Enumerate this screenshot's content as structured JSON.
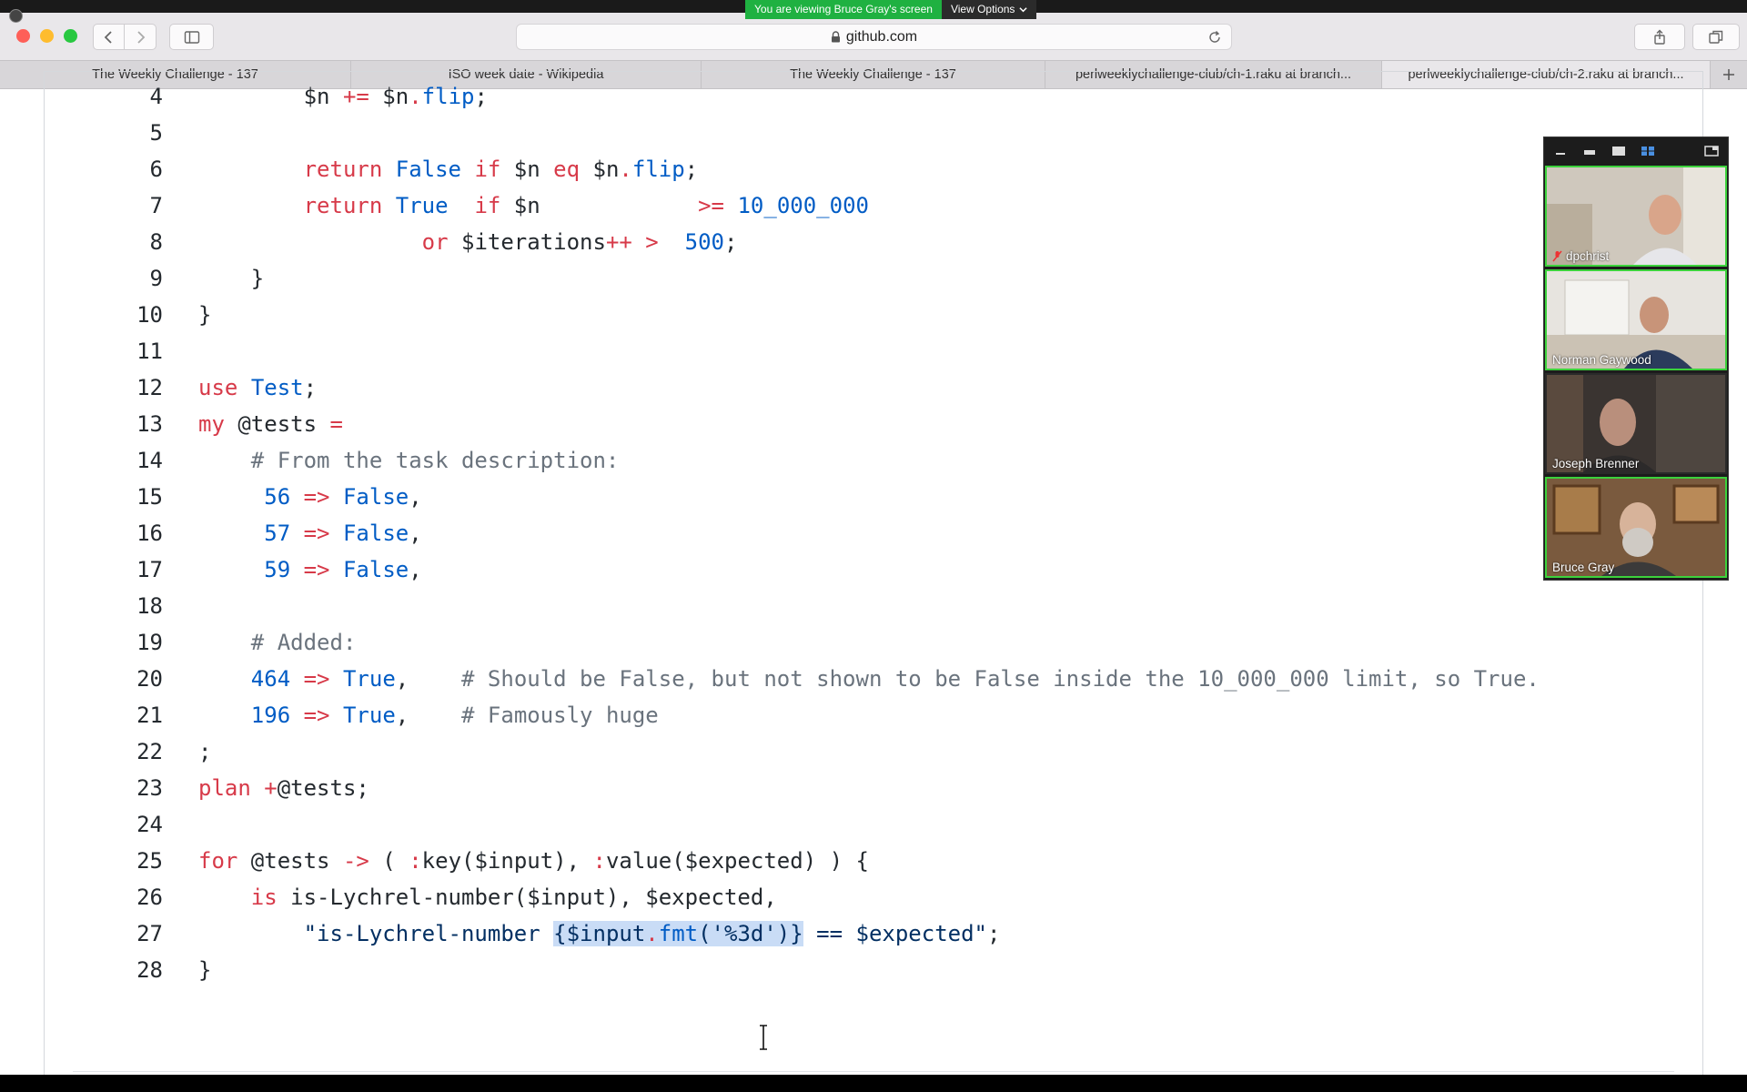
{
  "share_banner": {
    "viewing_text": "You are viewing Bruce Gray's screen",
    "view_options_label": "View Options"
  },
  "toolbar": {
    "url": "github.com",
    "icons": [
      "back-icon",
      "forward-icon",
      "sidebar-icon",
      "lock-icon",
      "reload-icon",
      "share-icon",
      "tabs-overview-icon"
    ]
  },
  "tabs": [
    {
      "label": "The Weekly Challenge - 137",
      "active": false
    },
    {
      "label": "ISO week date - Wikipedia",
      "active": false
    },
    {
      "label": "The Weekly Challenge - 137",
      "active": false
    },
    {
      "label": "perlweeklychallenge-club/ch-1.raku at branch...",
      "active": false
    },
    {
      "label": "perlweeklychallenge-club/ch-2.raku at branch...",
      "active": true
    }
  ],
  "code": {
    "lines": [
      {
        "n": "4",
        "segs": [
          [
            "",
            "        $n "
          ],
          [
            "kw",
            "+="
          ],
          [
            "",
            " $n"
          ],
          [
            "kw",
            "."
          ],
          [
            "fn",
            "flip"
          ],
          [
            "",
            ";"
          ]
        ]
      },
      {
        "n": "5",
        "segs": []
      },
      {
        "n": "6",
        "segs": [
          [
            "",
            "        "
          ],
          [
            "kw",
            "return"
          ],
          [
            "",
            " "
          ],
          [
            "fn",
            "False"
          ],
          [
            "",
            " "
          ],
          [
            "kw",
            "if"
          ],
          [
            "",
            " $n "
          ],
          [
            "kw",
            "eq"
          ],
          [
            "",
            " $n"
          ],
          [
            "kw",
            "."
          ],
          [
            "fn",
            "flip"
          ],
          [
            "",
            ";"
          ]
        ]
      },
      {
        "n": "7",
        "segs": [
          [
            "",
            "        "
          ],
          [
            "kw",
            "return"
          ],
          [
            "",
            " "
          ],
          [
            "fn",
            "True"
          ],
          [
            "",
            "  "
          ],
          [
            "kw",
            "if"
          ],
          [
            "",
            " $n            "
          ],
          [
            "kw",
            ">="
          ],
          [
            "",
            " "
          ],
          [
            "num",
            "10_000_000"
          ]
        ]
      },
      {
        "n": "8",
        "segs": [
          [
            "",
            "                 "
          ],
          [
            "kw",
            "or"
          ],
          [
            "",
            " $iterations"
          ],
          [
            "kw",
            "++"
          ],
          [
            "",
            " "
          ],
          [
            "kw",
            ">"
          ],
          [
            "",
            "  "
          ],
          [
            "num",
            "500"
          ],
          [
            "",
            ";"
          ]
        ]
      },
      {
        "n": "9",
        "segs": [
          [
            "",
            "    }"
          ]
        ]
      },
      {
        "n": "10",
        "segs": [
          [
            "",
            "}"
          ]
        ]
      },
      {
        "n": "11",
        "segs": []
      },
      {
        "n": "12",
        "segs": [
          [
            "kw",
            "use"
          ],
          [
            "",
            " "
          ],
          [
            "fn",
            "Test"
          ],
          [
            "",
            ";"
          ]
        ]
      },
      {
        "n": "13",
        "segs": [
          [
            "kw",
            "my"
          ],
          [
            "",
            " @tests "
          ],
          [
            "kw",
            "="
          ]
        ]
      },
      {
        "n": "14",
        "segs": [
          [
            "",
            "    "
          ],
          [
            "cm",
            "# From the task description:"
          ]
        ]
      },
      {
        "n": "15",
        "segs": [
          [
            "",
            "     "
          ],
          [
            "num",
            "56"
          ],
          [
            "",
            " "
          ],
          [
            "kw",
            "=>"
          ],
          [
            "",
            " "
          ],
          [
            "fn",
            "False"
          ],
          [
            "",
            ","
          ]
        ]
      },
      {
        "n": "16",
        "segs": [
          [
            "",
            "     "
          ],
          [
            "num",
            "57"
          ],
          [
            "",
            " "
          ],
          [
            "kw",
            "=>"
          ],
          [
            "",
            " "
          ],
          [
            "fn",
            "False"
          ],
          [
            "",
            ","
          ]
        ]
      },
      {
        "n": "17",
        "segs": [
          [
            "",
            "     "
          ],
          [
            "num",
            "59"
          ],
          [
            "",
            " "
          ],
          [
            "kw",
            "=>"
          ],
          [
            "",
            " "
          ],
          [
            "fn",
            "False"
          ],
          [
            "",
            ","
          ]
        ]
      },
      {
        "n": "18",
        "segs": []
      },
      {
        "n": "19",
        "segs": [
          [
            "",
            "    "
          ],
          [
            "cm",
            "# Added:"
          ]
        ]
      },
      {
        "n": "20",
        "segs": [
          [
            "",
            "    "
          ],
          [
            "num",
            "464"
          ],
          [
            "",
            " "
          ],
          [
            "kw",
            "=>"
          ],
          [
            "",
            " "
          ],
          [
            "fn",
            "True"
          ],
          [
            "",
            ",    "
          ],
          [
            "cm",
            "# Should be False, but not shown to be False inside the 10_000_000 limit, so True."
          ]
        ]
      },
      {
        "n": "21",
        "segs": [
          [
            "",
            "    "
          ],
          [
            "num",
            "196"
          ],
          [
            "",
            " "
          ],
          [
            "kw",
            "=>"
          ],
          [
            "",
            " "
          ],
          [
            "fn",
            "True"
          ],
          [
            "",
            ",    "
          ],
          [
            "cm",
            "# Famously huge"
          ]
        ]
      },
      {
        "n": "22",
        "segs": [
          [
            "",
            ";"
          ]
        ]
      },
      {
        "n": "23",
        "segs": [
          [
            "kw",
            "plan"
          ],
          [
            "",
            " "
          ],
          [
            "kw",
            "+"
          ],
          [
            "",
            "@tests;"
          ]
        ]
      },
      {
        "n": "24",
        "segs": []
      },
      {
        "n": "25",
        "segs": [
          [
            "kw",
            "for"
          ],
          [
            "",
            " @tests "
          ],
          [
            "kw",
            "->"
          ],
          [
            "",
            " ( "
          ],
          [
            "kw",
            ":"
          ],
          [
            "",
            "key($input), "
          ],
          [
            "kw",
            ":"
          ],
          [
            "",
            "value($expected) ) {"
          ]
        ]
      },
      {
        "n": "26",
        "segs": [
          [
            "",
            "    "
          ],
          [
            "kw",
            "is"
          ],
          [
            "",
            " is-Lychrel-number($input), $expected,"
          ]
        ]
      },
      {
        "n": "27",
        "segs": [
          [
            "",
            "        "
          ],
          [
            "str",
            "\"is-Lychrel-number "
          ],
          [
            "hl",
            "{$input"
          ],
          [
            "hlkw",
            "."
          ],
          [
            "hlfn",
            "fmt"
          ],
          [
            "hl",
            "('%3d')}"
          ],
          [
            "str",
            " == $expected\""
          ],
          [
            "",
            ";"
          ]
        ]
      },
      {
        "n": "28",
        "segs": [
          [
            "",
            "}"
          ]
        ]
      }
    ]
  },
  "participants": [
    {
      "name": "dpchrist",
      "muted": true,
      "active": true
    },
    {
      "name": "Norman Gaywood",
      "muted": false,
      "active": true
    },
    {
      "name": "Joseph Brenner",
      "muted": false,
      "active": false
    },
    {
      "name": "Bruce Gray",
      "muted": false,
      "active": true
    }
  ],
  "zoom_controls": [
    "minimize-icon",
    "strip-view-icon",
    "speaker-view-icon",
    "gallery-view-icon",
    "pop-out-icon"
  ],
  "colors": {
    "keyword": "#d73a49",
    "constant": "#005cc5",
    "comment": "#6a737d",
    "selection": "#c9dcf6",
    "share_green": "#1fb141",
    "active_speaker": "#3cd23c"
  }
}
